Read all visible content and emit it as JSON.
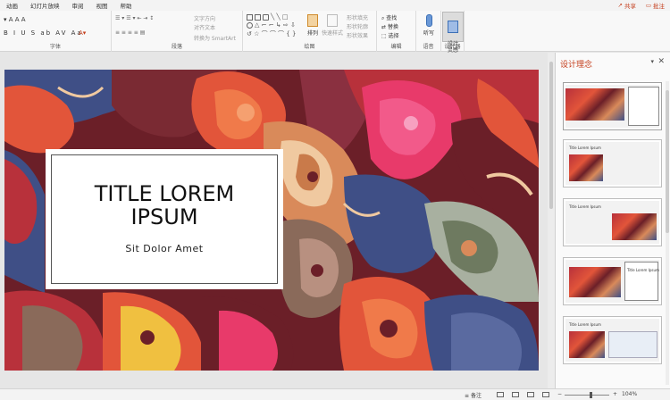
{
  "tabs": [
    {
      "label": "动画"
    },
    {
      "label": "幻灯片放映"
    },
    {
      "label": "审阅"
    },
    {
      "label": "视图"
    },
    {
      "label": "帮助"
    }
  ],
  "topbar": {
    "share_label": "共享",
    "comment_label": "批注"
  },
  "ribbon": {
    "groups": {
      "font": "字体",
      "paragraph": "段落",
      "drawing": "绘图",
      "editing": "编辑",
      "voice": "语音",
      "designer": "设计器"
    },
    "paragraph_controls": {
      "text_direction": "文字方向",
      "align_text": "对齐文本",
      "smartart": "转换为 SmartArt"
    },
    "drawing_controls": {
      "arrange": "排列",
      "quick_styles": "快速样式",
      "shape_fill": "形状填充",
      "shape_outline": "形状轮廓",
      "shape_effects": "形状效果"
    },
    "editing_controls": {
      "find": "查找",
      "replace": "替换",
      "select": "选择"
    },
    "voice_controls": {
      "dictate": "听写"
    },
    "designer_controls": {
      "design_ideas": "设计\n灵感"
    }
  },
  "slide": {
    "title_line1": "TITLE LOREM",
    "title_line2": "IPSUM",
    "subtitle": "Sit Dolor Amet"
  },
  "pane": {
    "title": "设计理念",
    "thumbnails": [
      {
        "title": "",
        "selected": true
      },
      {
        "title": "Title Lorem Ipsum",
        "selected": false
      },
      {
        "title": "Title Lorem Ipsum",
        "selected": false
      },
      {
        "title": "Title Lorem Ipsum",
        "selected": false
      },
      {
        "title": "Title Lorem Ipsum",
        "selected": false
      }
    ]
  },
  "status": {
    "notes_label": "备注",
    "zoom": "104%"
  },
  "colors": {
    "accent": "#c43e1c",
    "slide_bg": "#6b1f28"
  }
}
